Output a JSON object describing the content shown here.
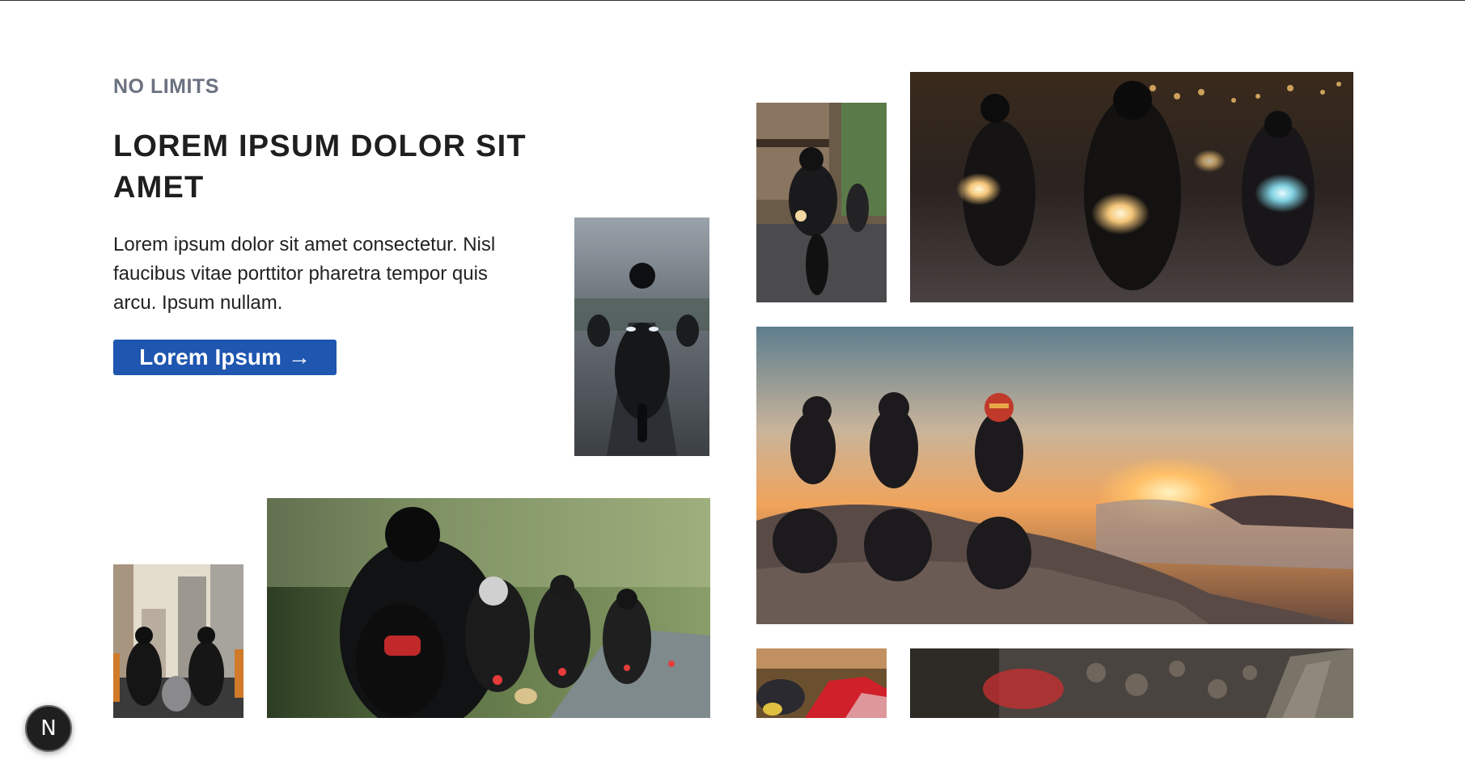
{
  "hero": {
    "eyebrow": "NO LIMITS",
    "title": "LOREM IPSUM DOLOR SIT AMET",
    "body": "Lorem ipsum dolor sit amet consectetur. Nisl faucibus vitae porttitor pharetra tempor quis arcu. Ipsum nullam.",
    "cta_label": "Lorem Ipsum",
    "cta_arrow": "→"
  },
  "gallery": {
    "photos": [
      {
        "subject": "rider-on-sportbike-road"
      },
      {
        "subject": "rider-in-city-street"
      },
      {
        "subject": "night-riders-headlights"
      },
      {
        "subject": "riders-at-sunset-cliff"
      },
      {
        "subject": "riders-in-city-towers"
      },
      {
        "subject": "motorcycle-group-forest-road"
      },
      {
        "subject": "motorcycles-parked"
      },
      {
        "subject": "motorcycle-blurred-closeup"
      }
    ]
  },
  "badge": {
    "letter": "N"
  },
  "colors": {
    "accent": "#1e56b0",
    "eyebrow": "#6b7280",
    "title": "#1f1f1f"
  }
}
